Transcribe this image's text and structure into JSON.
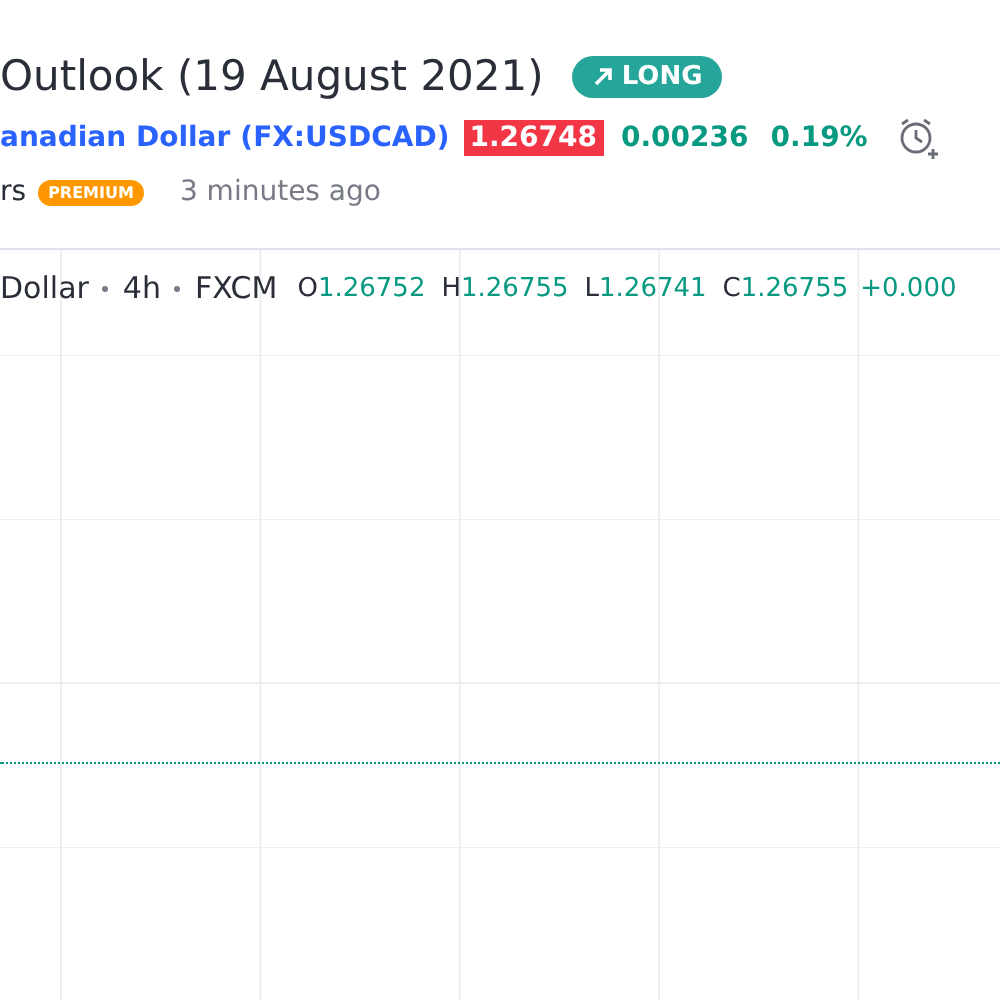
{
  "idea": {
    "title": "Outlook (19 August 2021)",
    "direction": {
      "label": "LONG",
      "kind": "long"
    },
    "symbol": {
      "name": "anadian Dollar",
      "ticker": "(FX:USDCAD)",
      "price": "1.26748",
      "change": "0.00236",
      "change_percent": "0.19%"
    },
    "author": {
      "name": "rs",
      "badge": "PREMIUM",
      "time": "3 minutes ago"
    }
  },
  "chart": {
    "legend": {
      "symbol": "Dollar",
      "interval": "4h",
      "source": "FXCM",
      "ohlc": [
        {
          "label": "O",
          "value": "1.26752"
        },
        {
          "label": "H",
          "value": "1.26755"
        },
        {
          "label": "L",
          "value": "1.26741"
        },
        {
          "label": "C",
          "value": "1.26755"
        }
      ],
      "change": "+0.000"
    }
  }
}
